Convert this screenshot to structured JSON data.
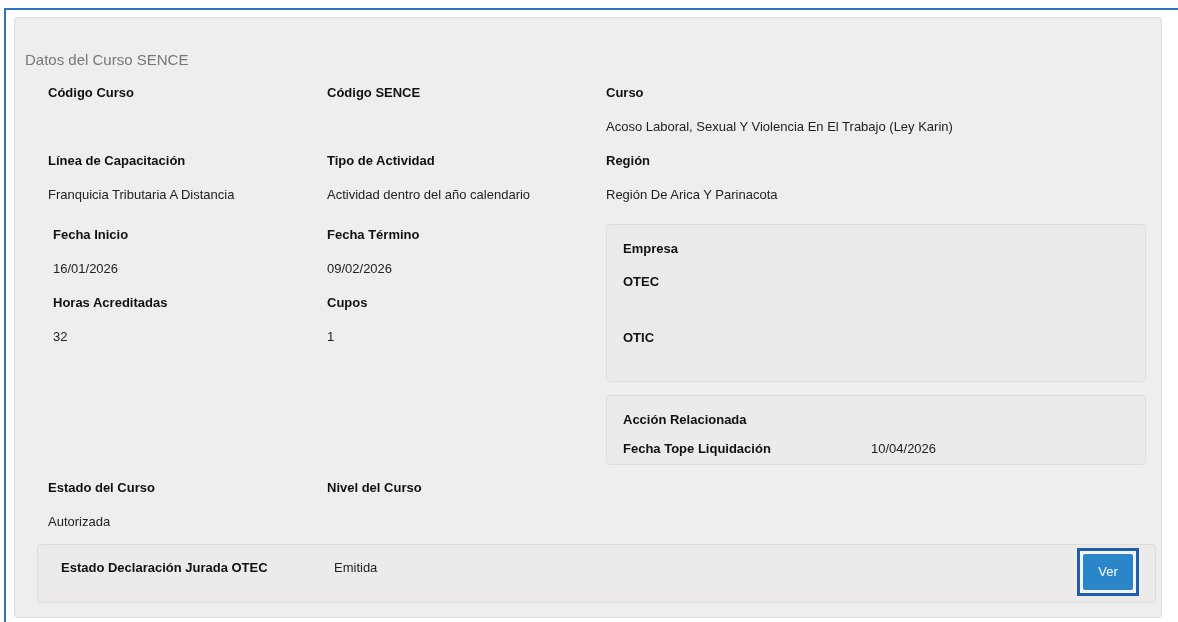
{
  "section_title": "Datos del Curso SENCE",
  "top_fields": [
    {
      "label": "Código Curso"
    },
    {
      "label": "Código SENCE"
    },
    {
      "label": "Curso",
      "value": "Acoso Laboral, Sexual Y Violencia En El Trabajo (Ley Karin)"
    },
    {
      "label": "Línea de Capacitación",
      "value": "Franquicia Tributaria A Distancia"
    },
    {
      "label": "Tipo de Actividad",
      "value": "Actividad dentro del año calendario"
    },
    {
      "label": "Región",
      "value": "Región De Arica Y Parinacota"
    }
  ],
  "date_fields": [
    {
      "label": "Fecha Inicio",
      "value": "16/01/2026"
    },
    {
      "label": "Fecha Término",
      "value": "09/02/2026"
    },
    {
      "label": "Horas Acreditadas",
      "value": "32"
    },
    {
      "label": "Cupos",
      "value": "1"
    }
  ],
  "empresa_box": {
    "title": "Empresa",
    "items": [
      "OTEC",
      "OTIC"
    ]
  },
  "accion_box": {
    "title": "Acción Relacionada",
    "label": "Fecha Tope Liquidación",
    "value": "10/04/2026"
  },
  "status_fields": [
    {
      "label": "Estado del Curso",
      "value": "Autorizada"
    },
    {
      "label": "Nivel del Curso"
    }
  ],
  "declaration": {
    "label": "Estado Declaración Jurada OTEC",
    "value": "Emitida",
    "button": "Ver"
  }
}
